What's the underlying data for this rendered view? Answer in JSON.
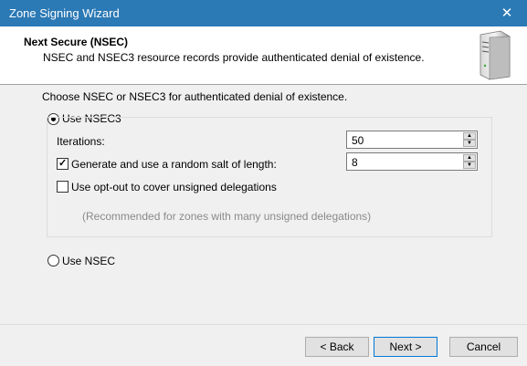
{
  "window": {
    "title": "Zone Signing Wizard",
    "close_glyph": "✕"
  },
  "header": {
    "title": "Next Secure (NSEC)",
    "subtitle": "NSEC and NSEC3 resource records provide authenticated denial of existence.",
    "icon": "server-icon"
  },
  "main": {
    "prompt": "Choose NSEC or NSEC3 for authenticated denial of existence.",
    "nsec3": {
      "label": "Use NSEC3",
      "selected": true,
      "iterations_label": "Iterations:",
      "iterations_value": "50",
      "salt_label": "Generate and use a random salt of length:",
      "salt_checked": true,
      "salt_value": "8",
      "optout_label": "Use opt-out to cover unsigned delegations",
      "optout_checked": false,
      "optout_note": "(Recommended for zones with many unsigned delegations)"
    },
    "nsec": {
      "label": "Use NSEC",
      "selected": false
    }
  },
  "footer": {
    "back_label": "< Back",
    "next_label": "Next >",
    "cancel_label": "Cancel"
  },
  "spin_glyphs": {
    "up": "▲",
    "down": "▼",
    "check": "✓"
  }
}
